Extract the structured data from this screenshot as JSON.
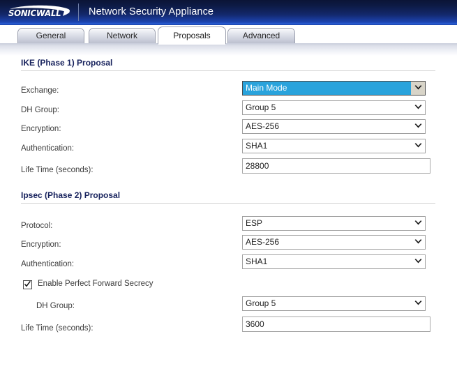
{
  "header": {
    "logo": "SONICWALL",
    "logo_icon": "sonicwall-swoosh-logo",
    "title": "Network Security Appliance"
  },
  "tabs": [
    {
      "label": "General",
      "active": false
    },
    {
      "label": "Network",
      "active": false
    },
    {
      "label": "Proposals",
      "active": true
    },
    {
      "label": "Advanced",
      "active": false
    }
  ],
  "sections": {
    "phase1": {
      "heading": "IKE (Phase 1) Proposal",
      "fields": {
        "exchange": {
          "label": "Exchange:",
          "value": "Main Mode",
          "type": "select",
          "focused": true
        },
        "dh_group": {
          "label": "DH Group:",
          "value": "Group 5",
          "type": "select"
        },
        "encryption": {
          "label": "Encryption:",
          "value": "AES-256",
          "type": "select"
        },
        "authentication": {
          "label": "Authentication:",
          "value": "SHA1",
          "type": "select"
        },
        "life_time": {
          "label": "Life Time (seconds):",
          "value": "28800",
          "type": "text"
        }
      }
    },
    "phase2": {
      "heading": "Ipsec (Phase 2) Proposal",
      "fields": {
        "protocol": {
          "label": "Protocol:",
          "value": "ESP",
          "type": "select"
        },
        "encryption": {
          "label": "Encryption:",
          "value": "AES-256",
          "type": "select"
        },
        "authentication": {
          "label": "Authentication:",
          "value": "SHA1",
          "type": "select"
        },
        "pfs": {
          "label": "Enable Perfect Forward Secrecy",
          "checked": true,
          "type": "checkbox"
        },
        "dh_group": {
          "label": "DH Group:",
          "value": "Group 5",
          "type": "select"
        },
        "life_time": {
          "label": "Life Time (seconds):",
          "value": "3600",
          "type": "text"
        }
      }
    }
  },
  "colors": {
    "header_top": "#0d1a44",
    "header_bottom": "#2a62d8",
    "section_heading": "#16215c",
    "selection_highlight": "#29a3dc"
  }
}
